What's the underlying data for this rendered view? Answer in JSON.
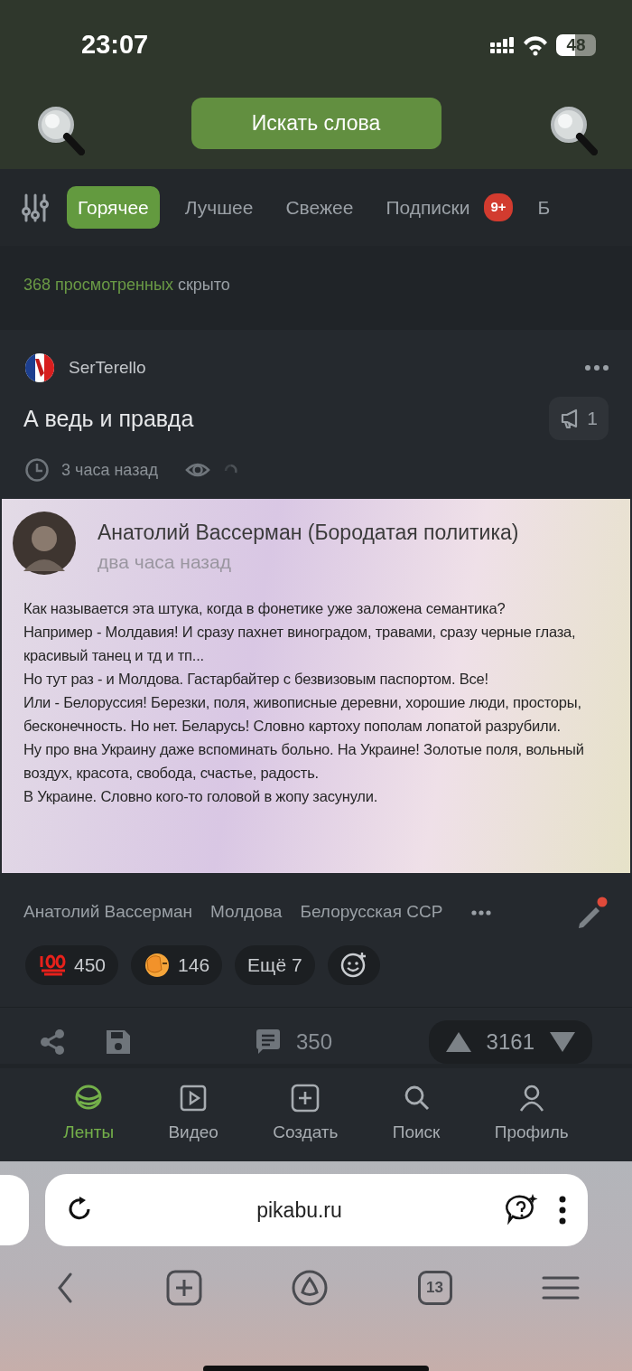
{
  "status_bar": {
    "time": "23:07",
    "battery": "48"
  },
  "search_button": {
    "label": "Искать слова"
  },
  "tabs": [
    {
      "label": "Горячее",
      "selected": true
    },
    {
      "label": "Лучшее",
      "selected": false
    },
    {
      "label": "Свежее",
      "selected": false
    },
    {
      "label": "Подписки",
      "selected": false,
      "badge": "9+"
    },
    {
      "label": "Б",
      "selected": false
    }
  ],
  "hidden_note": {
    "link": "368 просмотренных",
    "text": "скрыто"
  },
  "post": {
    "author": "SerTerello",
    "title": "А ведь и правда",
    "boost_count": "1",
    "time": "3 часа назад",
    "screenshot": {
      "name": "Анатолий Вассерман (Бородатая политика)",
      "time": "два часа назад",
      "paragraphs": [
        "Как называется эта штука, когда в фонетике уже заложена семантика?",
        "Например - Молдавия! И сразу пахнет виноградом, травами, сразу черные глаза, красивый танец и тд и тп...",
        "Но тут раз - и Молдова. Гастарбайтер с безвизовым паспортом. Все!",
        "Или - Белоруссия! Березки, поля, живописные деревни, хорошие люди, просторы, бесконечность. Но нет. Беларусь! Словно картоху пополам лопатой разрубили.",
        "Ну про вна Украину даже вспоминать больно. На Украине! Золотые поля, вольный воздух, красота, свобода, счастье, радость.",
        "В Украине. Словно кого-то головой в жопу засунули."
      ]
    },
    "tags": [
      "Анатолий Вассерман",
      "Молдова",
      "Белорусская ССР"
    ],
    "reactions": [
      {
        "kind": "hundred",
        "count": "450"
      },
      {
        "kind": "facepalm",
        "count": "146"
      },
      {
        "kind": "more",
        "label": "Ещё 7"
      }
    ],
    "comments": "350",
    "rating": "3161"
  },
  "bottom_nav": [
    {
      "label": "Ленты",
      "selected": true
    },
    {
      "label": "Видео",
      "selected": false
    },
    {
      "label": "Создать",
      "selected": false
    },
    {
      "label": "Поиск",
      "selected": false
    },
    {
      "label": "Профиль",
      "selected": false
    }
  ],
  "browser": {
    "url": "pikabu.ru",
    "tab_count": "13"
  }
}
